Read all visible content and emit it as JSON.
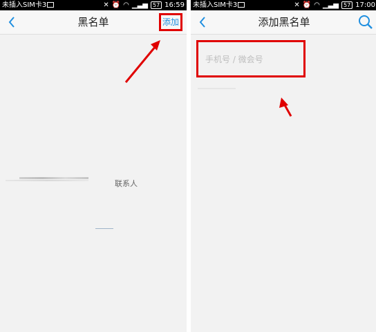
{
  "left_screen": {
    "status": {
      "carrier": "未插入SIM卡3",
      "battery": "57",
      "time": "16:59"
    },
    "title": "黑名单",
    "add_label": "添加",
    "contact_label": "联系人"
  },
  "right_screen": {
    "status": {
      "carrier": "未插入SIM卡3",
      "battery": "57",
      "time": "17:00"
    },
    "title": "添加黑名单",
    "input_placeholder": "手机号 / 微会号",
    "input_value": ""
  },
  "colors": {
    "accent": "#1f8fe0",
    "highlight": "#e00000",
    "background": "#f2f2f2"
  }
}
